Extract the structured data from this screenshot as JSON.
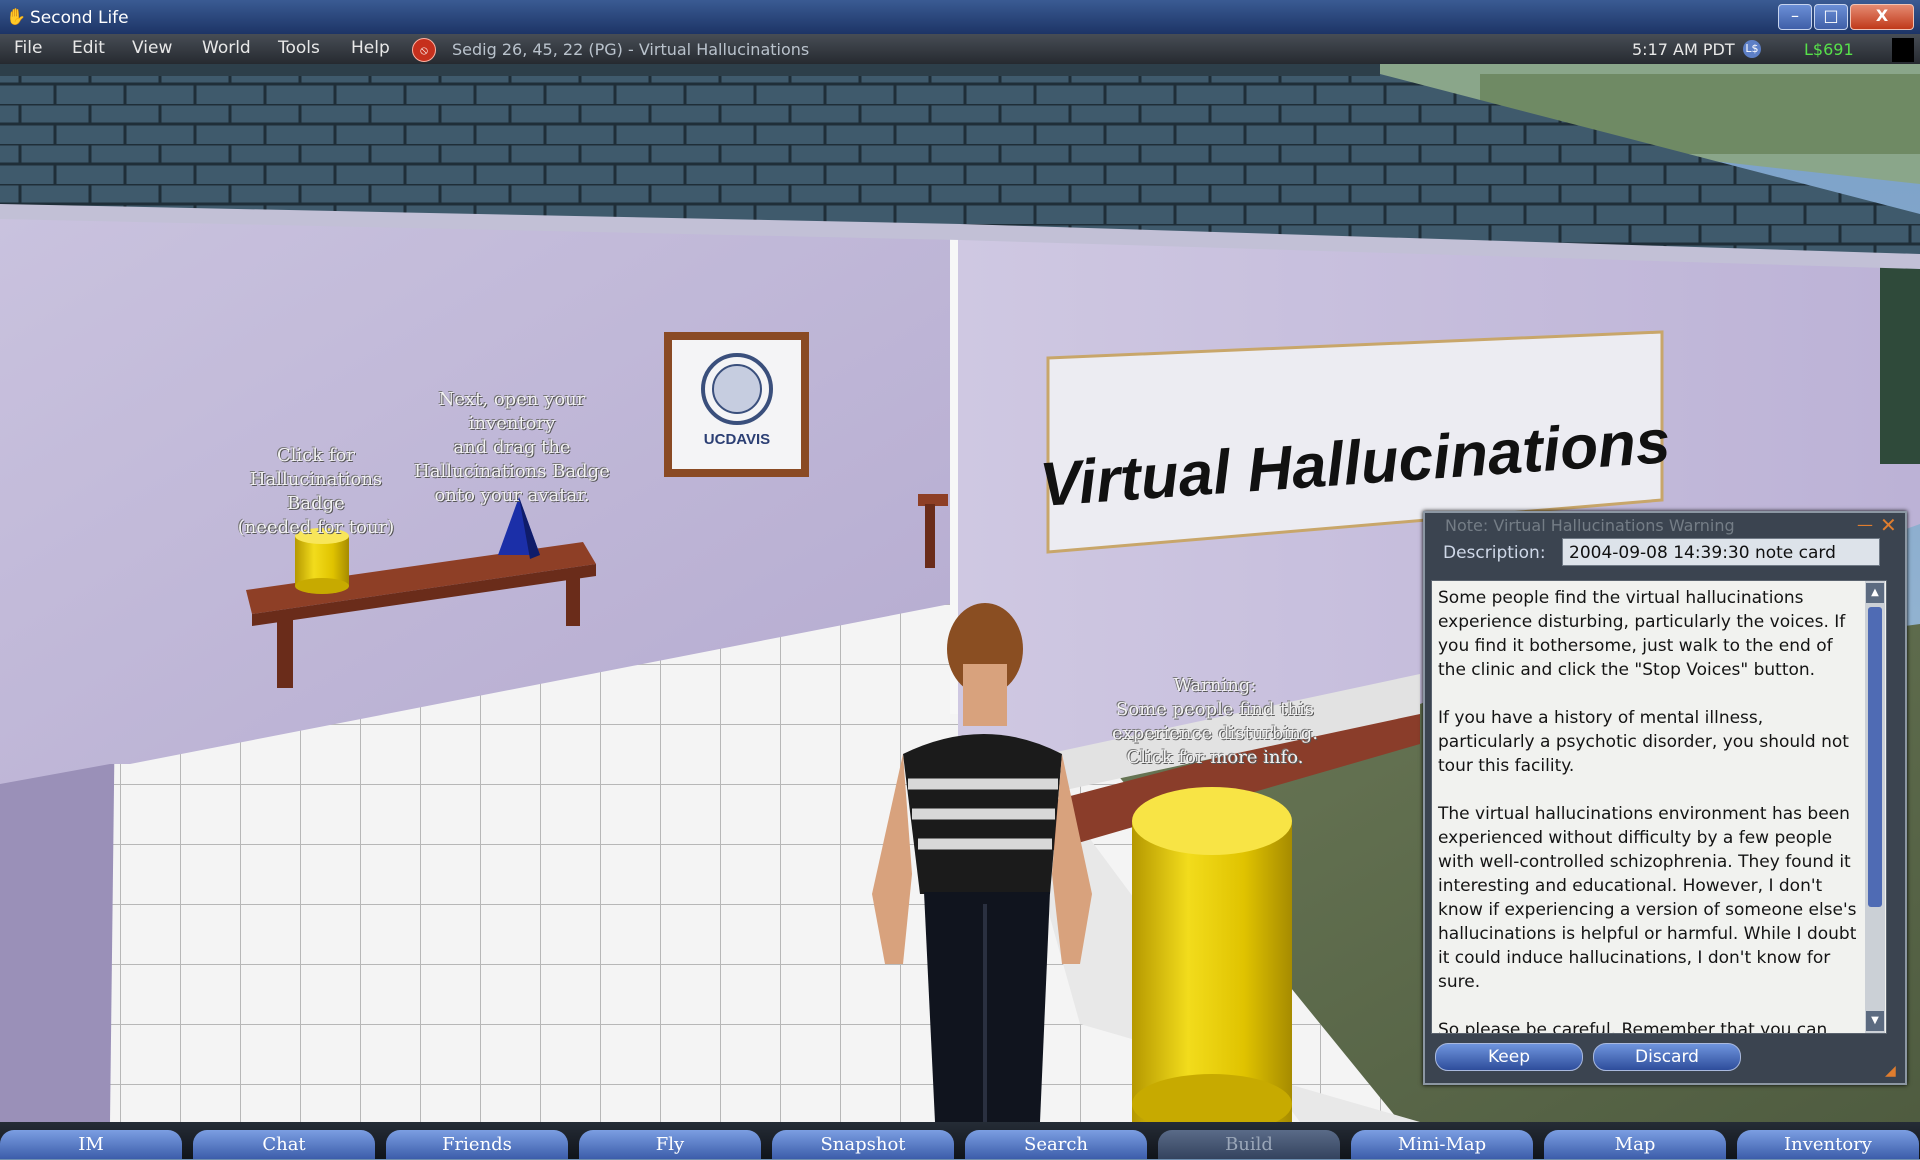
{
  "window": {
    "title": "Second Life",
    "minimize": "–",
    "maximize": "□",
    "close": "X"
  },
  "menu": {
    "items": [
      "File",
      "Edit",
      "View",
      "World",
      "Tools",
      "Help"
    ],
    "location": "Sedig 26, 45, 22 (PG) - Virtual Hallucinations",
    "time": "5:17 AM PDT",
    "balance": "L$691"
  },
  "scene": {
    "badge_hover_text": "Click for\nHallucinations Badge\n(needed for tour)",
    "inventory_hover_text": "Next, open your inventory\nand drag the\nHallucinations Badge\nonto your avatar.",
    "warning_hover_text": "Warning:\nSome people find this\nexperience disturbing.\nClick for more info.",
    "banner_text": "Virtual Hallucinations",
    "logo_text": "UCDAVIS"
  },
  "notecard": {
    "title": "Note: Virtual Hallucinations Warning",
    "description_label": "Description:",
    "description_value": "2004-09-08 14:39:30 note card",
    "body": "Some people find the virtual hallucinations experience disturbing, particularly the voices. If you find it bothersome, just walk to the end of the clinic and click the \"Stop Voices\" button.\n\nIf you have a history of mental illness, particularly a psychotic disorder, you should not tour this facility.\n\nThe virtual hallucinations environment has been experienced without difficulty by a few people with well-controlled schizophrenia. They found it interesting and educational. However, I don't know if experiencing a version of someone else's hallucinations is helpful or harmful. While I doubt it could induce hallucinations, I don't know for sure.\n\nSo please be careful. Remember that you can quit",
    "keep_label": "Keep",
    "discard_label": "Discard"
  },
  "toolbar": {
    "buttons": [
      {
        "label": "IM",
        "enabled": true
      },
      {
        "label": "Chat",
        "enabled": true
      },
      {
        "label": "Friends",
        "enabled": true
      },
      {
        "label": "Fly",
        "enabled": true
      },
      {
        "label": "Snapshot",
        "enabled": true
      },
      {
        "label": "Search",
        "enabled": true
      },
      {
        "label": "Build",
        "enabled": false
      },
      {
        "label": "Mini-Map",
        "enabled": true
      },
      {
        "label": "Map",
        "enabled": true
      },
      {
        "label": "Inventory",
        "enabled": true
      }
    ]
  },
  "colors": {
    "title_bar": "#1d3466",
    "menu_bar": "#262a30",
    "balance": "#57e04a",
    "dialog_accent": "#e07d2e",
    "toolbar_button": "#3c5daa"
  }
}
